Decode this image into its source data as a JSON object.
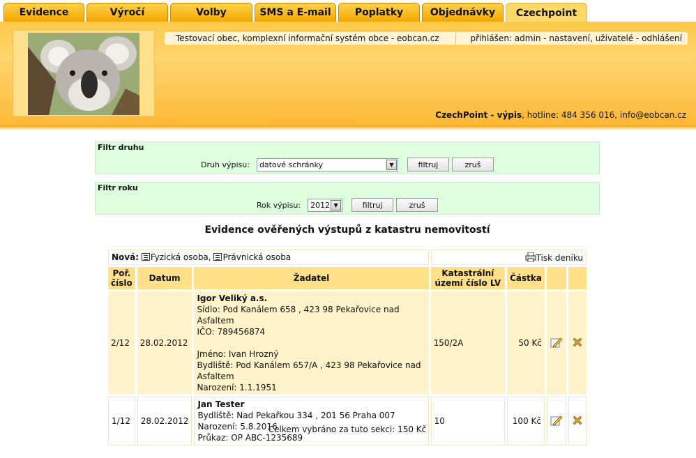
{
  "tabs": [
    {
      "label": "Evidence"
    },
    {
      "label": "Výročí"
    },
    {
      "label": "Volby"
    },
    {
      "label": "SMS a E-mail"
    },
    {
      "label": "Poplatky"
    },
    {
      "label": "Objednávky"
    },
    {
      "label": "Czechpoint"
    }
  ],
  "header": {
    "info_left": "Testovací obec, komplexní informační systém obce - eobcan.cz",
    "info_right": "přihlášen: admin - nastavení, uživatelé - odhlášení",
    "hotline_bold": "CzechPoint - výpis",
    "hotline_rest": ", hotline: 484 356 016, info@eobcan.cz"
  },
  "filter_type": {
    "title": "Filtr druhu",
    "label": "Druh výpisu:",
    "selected": "datové schránky",
    "filter_button": "filtruj",
    "cancel_button": "zruš"
  },
  "filter_year": {
    "title": "Filtr roku",
    "label": "Rok výpisu:",
    "selected": "2012",
    "filter_button": "filtruj",
    "cancel_button": "zruš"
  },
  "section_title": "Evidence ověřených výstupů z katastru nemovitostí",
  "new": {
    "label": "Nová:",
    "person": "Fyzická osoba,",
    "company": "Právnická osoba",
    "print": "Tisk deníku"
  },
  "columns": {
    "order": "Poř. číslo",
    "date": "Datum",
    "applicant": "Žadatel",
    "cadastre": "Katastrální území číslo LV",
    "amount": "Částka"
  },
  "rows": [
    {
      "order": "2/12",
      "date": "28.02.2012",
      "name": "Igor Veliký a.s.",
      "line1": "Sídlo: Pod Kanálem 658 , 423 98 Pekařovice nad Asfaltem",
      "line2": "IČO: 789456874",
      "line3": "Jméno: Ivan Hrozný",
      "line4": "Bydliště: Pod Kanálem 657/A , 423 98 Pekařovice nad Asfaltem",
      "line5": "Narození: 1.1.1951",
      "cadastre": "150/2A",
      "amount": "50 Kč"
    },
    {
      "order": "1/12",
      "date": "28.02.2012",
      "name": "Jan Tester",
      "line1": "Bydliště: Nad Pekařkou 334 , 201 56 Praha 007",
      "line2": "Narození: 5.8.2016",
      "line3": "Průkaz: OP ABC-1235689",
      "cadastre": "10",
      "amount": "100 Kč"
    }
  ],
  "total": "Celkem vybráno za tuto sekci: 150 Kč"
}
